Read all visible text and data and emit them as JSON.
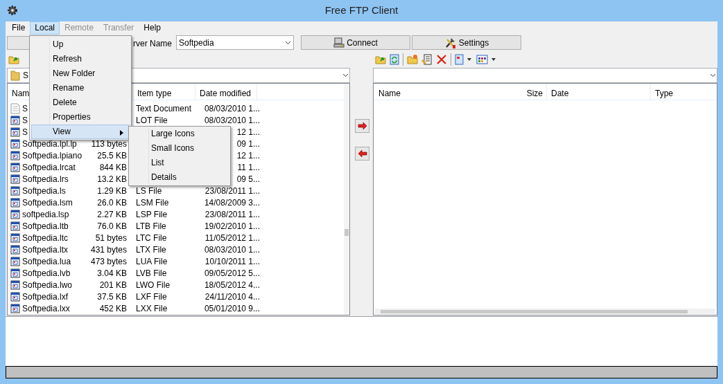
{
  "window": {
    "title": "Free FTP Client"
  },
  "menu_bar": [
    {
      "label": "File",
      "selected": false,
      "disabled": false
    },
    {
      "label": "Local",
      "selected": true,
      "disabled": false
    },
    {
      "label": "Remote",
      "selected": false,
      "disabled": true
    },
    {
      "label": "Transfer",
      "selected": false,
      "disabled": true
    },
    {
      "label": "Help",
      "selected": false,
      "disabled": false
    }
  ],
  "connection_bar": {
    "server_label": "rver Name",
    "server_name": "Softpedia",
    "buttons": [
      "Connect",
      "Settings"
    ]
  },
  "local_pane": {
    "path": "S",
    "columns": [
      "Nam",
      "Item type",
      "Date modified"
    ],
    "rows": [
      {
        "kind": "text",
        "name": "S",
        "type": "Text Document",
        "date": "08/03/2010 1..."
      },
      {
        "kind": "app",
        "name": "S",
        "type": "LOT File",
        "date": "08/03/2010 1..."
      },
      {
        "kind": "app",
        "name": "S",
        "date": "12 1..."
      },
      {
        "kind": "app",
        "name": "Softpedia.lpl.lp",
        "size": "113 bytes",
        "date": "09 1..."
      },
      {
        "kind": "app",
        "name": "Softpedia.lpiano",
        "size": "25.5 KB",
        "date": "12 1..."
      },
      {
        "kind": "app",
        "name": "Softpedia.lrcat",
        "size": "844 KB",
        "date": "11 1..."
      },
      {
        "kind": "app",
        "name": "Softpedia.lrs",
        "size": "13.2 KB",
        "date": "09 5..."
      },
      {
        "kind": "app",
        "name": "Softpedia.ls",
        "size": "1.29 KB",
        "type": "LS File",
        "date": "23/08/2011 1..."
      },
      {
        "kind": "app",
        "name": "Softpedia.lsm",
        "size": "26.0 KB",
        "type": "LSM File",
        "date": "14/08/2009 3..."
      },
      {
        "kind": "app",
        "name": "softpedia.lsp",
        "size": "2.27 KB",
        "type": "LSP File",
        "date": "23/08/2011 1..."
      },
      {
        "kind": "app",
        "name": "Softpedia.ltb",
        "size": "76.0 KB",
        "type": "LTB File",
        "date": "19/02/2010 1..."
      },
      {
        "kind": "app",
        "name": "Softpedia.ltc",
        "size": "51 bytes",
        "type": "LTC File",
        "date": "11/05/2012 1..."
      },
      {
        "kind": "app",
        "name": "Softpedia.ltx",
        "size": "431 bytes",
        "type": "LTX File",
        "date": "08/03/2010 1..."
      },
      {
        "kind": "app",
        "name": "Softpedia.lua",
        "size": "473 bytes",
        "type": "LUA File",
        "date": "10/10/2011 1..."
      },
      {
        "kind": "app",
        "name": "Softpedia.lvb",
        "size": "3.04 KB",
        "type": "LVB File",
        "date": "09/05/2012 5..."
      },
      {
        "kind": "app",
        "name": "Softpedia.lwo",
        "size": "201 KB",
        "type": "LWO File",
        "date": "18/05/2012 4..."
      },
      {
        "kind": "app",
        "name": "Softpedia.lxf",
        "size": "37.5 KB",
        "type": "LXF File",
        "date": "24/11/2010 4..."
      },
      {
        "kind": "app",
        "name": "Softpedia.lxx",
        "size": "452 KB",
        "type": "LXX File",
        "date": "05/01/2010 9..."
      }
    ]
  },
  "remote_pane": {
    "columns": [
      "Name",
      "Size",
      "Date",
      "Type"
    ]
  },
  "local_menu": [
    {
      "label": "Up",
      "selected": false,
      "submenu": false
    },
    {
      "label": "Refresh",
      "selected": false,
      "submenu": false
    },
    {
      "label": "New Folder",
      "selected": false,
      "submenu": false
    },
    {
      "label": "Rename",
      "selected": false,
      "submenu": false
    },
    {
      "label": "Delete",
      "selected": false,
      "submenu": false
    },
    {
      "label": "Properties",
      "selected": false,
      "submenu": false
    },
    {
      "label": "View",
      "selected": true,
      "submenu": true
    }
  ],
  "view_submenu": [
    "Large Icons",
    "Small Icons",
    "List",
    "Details"
  ]
}
